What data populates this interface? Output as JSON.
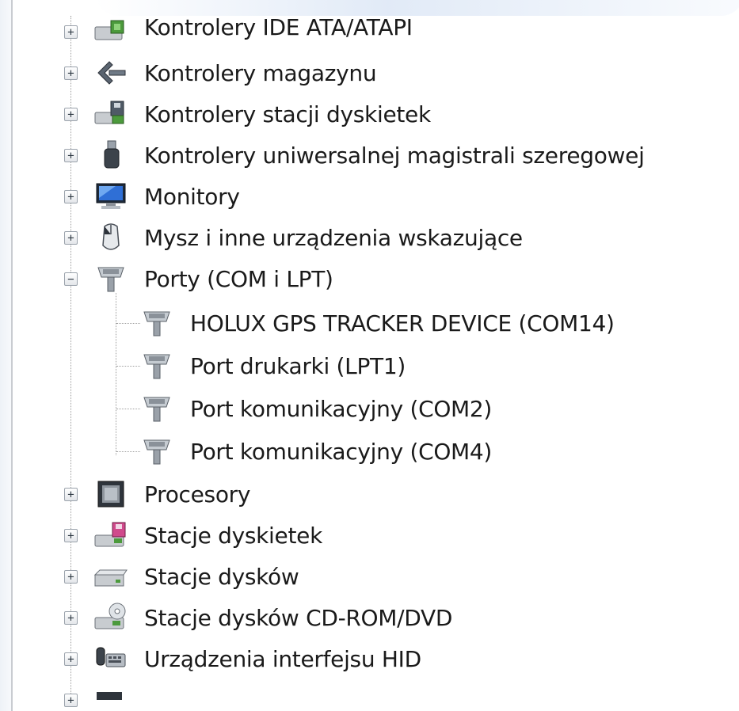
{
  "device_tree": {
    "items": [
      {
        "label": "Kontrolery IDE ATA/ATAPI",
        "icon": "ide-controller-icon",
        "expander": "+",
        "level": 0
      },
      {
        "label": "Kontrolery magazynu",
        "icon": "storage-controller-icon",
        "expander": "+",
        "level": 0
      },
      {
        "label": "Kontrolery stacji dyskietek",
        "icon": "floppy-controller-icon",
        "expander": "+",
        "level": 0
      },
      {
        "label": "Kontrolery uniwersalnej magistrali szeregowej",
        "icon": "usb-controller-icon",
        "expander": "+",
        "level": 0
      },
      {
        "label": "Monitory",
        "icon": "monitor-icon",
        "expander": "+",
        "level": 0
      },
      {
        "label": "Mysz i inne urządzenia wskazujące",
        "icon": "mouse-icon",
        "expander": "+",
        "level": 0
      },
      {
        "label": "Porty (COM i LPT)",
        "icon": "port-connector-icon",
        "expander": "−",
        "level": 0
      },
      {
        "label": "HOLUX GPS TRACKER DEVICE (COM14)",
        "icon": "port-connector-icon",
        "expander": "",
        "level": 1
      },
      {
        "label": "Port drukarki (LPT1)",
        "icon": "port-connector-icon",
        "expander": "",
        "level": 1
      },
      {
        "label": "Port komunikacyjny (COM2)",
        "icon": "port-connector-icon",
        "expander": "",
        "level": 1
      },
      {
        "label": "Port komunikacyjny (COM4)",
        "icon": "port-connector-icon",
        "expander": "",
        "level": 1
      },
      {
        "label": "Procesory",
        "icon": "processor-icon",
        "expander": "+",
        "level": 0
      },
      {
        "label": "Stacje dyskietek",
        "icon": "floppy-drive-icon",
        "expander": "+",
        "level": 0
      },
      {
        "label": "Stacje dysków",
        "icon": "disk-drive-icon",
        "expander": "+",
        "level": 0
      },
      {
        "label": "Stacje dysków CD-ROM/DVD",
        "icon": "cd-dvd-drive-icon",
        "expander": "+",
        "level": 0
      },
      {
        "label": "Urządzenia interfejsu HID",
        "icon": "hid-device-icon",
        "expander": "+",
        "level": 0
      },
      {
        "label": "",
        "icon": "partially-visible-device-icon",
        "expander": "+",
        "level": 0
      }
    ]
  },
  "colors": {
    "text": "#1a1a1a",
    "tree_lines": "#a0a0a0",
    "expander_border": "#9aa2ab"
  }
}
